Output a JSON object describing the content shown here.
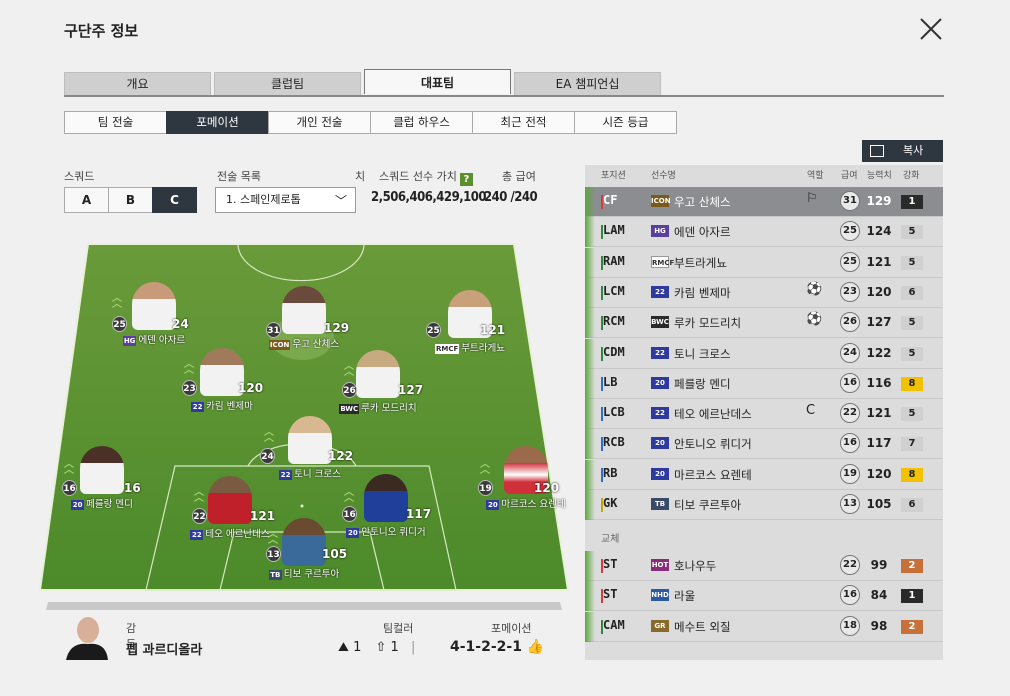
{
  "header": {
    "title": "구단주 정보"
  },
  "main_tabs": [
    "개요",
    "클럽팀",
    "대표팀",
    "EA 챔피언십"
  ],
  "sub_tabs": [
    "팀 전술",
    "포메이션",
    "개인 전술",
    "클럽 하우스",
    "최근 전적",
    "시즌 등급"
  ],
  "squad": {
    "label": "스쿼드",
    "options": [
      "A",
      "B",
      "C"
    ],
    "selected": "C"
  },
  "tactics": {
    "label": "전술 목록",
    "value": "1. 스페인제로톱",
    "cut_label": "치"
  },
  "squad_value": {
    "label": "스쿼드 선수 가치",
    "help": "?",
    "value": "2,506,406,429,100"
  },
  "salary": {
    "label": "총 급여",
    "value": "240 /240"
  },
  "copy_button": {
    "label": "복사",
    "icon_text": "복사"
  },
  "table_headers": {
    "pos": "포지션",
    "name": "선수명",
    "role": "역할",
    "salary": "급여",
    "ovr": "능력치",
    "up": "강화"
  },
  "starters": [
    {
      "pos": "CF",
      "season": "ICON",
      "season_color": "#7a5a1a",
      "name": "우고 산체스",
      "role": "⚐",
      "salary": "31",
      "ovr": "129",
      "up": "1",
      "up_color": "#2a2a2a",
      "pos_color": "#d93a3a",
      "selected": true
    },
    {
      "pos": "LAM",
      "season": "HG",
      "season_color": "#5b3fa0",
      "name": "에덴 아자르",
      "role": "",
      "salary": "25",
      "ovr": "124",
      "up": "5",
      "up_color": "#d0d0d0",
      "pos_color": "#2b8a3e"
    },
    {
      "pos": "RAM",
      "season": "RMCF",
      "season_color": "#ffffff",
      "name": "부트라게뇨",
      "role": "",
      "salary": "25",
      "ovr": "121",
      "up": "5",
      "up_color": "#d0d0d0",
      "pos_color": "#2b8a3e"
    },
    {
      "pos": "LCM",
      "season": "22",
      "season_color": "#2f3a9e",
      "name": "카림 벤제마",
      "role": "⚽",
      "salary": "23",
      "ovr": "120",
      "up": "6",
      "up_color": "#d0d0d0",
      "pos_color": "#2b8a3e"
    },
    {
      "pos": "RCM",
      "season": "BWC",
      "season_color": "#2a2a2a",
      "name": "루카 모드리치",
      "role": "⚽",
      "salary": "26",
      "ovr": "127",
      "up": "5",
      "up_color": "#d0d0d0",
      "pos_color": "#2b8a3e"
    },
    {
      "pos": "CDM",
      "season": "22",
      "season_color": "#2f3a9e",
      "name": "토니 크로스",
      "role": "",
      "salary": "24",
      "ovr": "122",
      "up": "5",
      "up_color": "#d0d0d0",
      "pos_color": "#2b8a3e"
    },
    {
      "pos": "LB",
      "season": "20",
      "season_color": "#2f3a9e",
      "name": "페를랑 멘디",
      "role": "",
      "salary": "16",
      "ovr": "116",
      "up": "8",
      "up_color": "#f2c200",
      "pos_color": "#2a6fc9"
    },
    {
      "pos": "LCB",
      "season": "22",
      "season_color": "#2f3a9e",
      "name": "테오 에르난데스",
      "role": "C",
      "salary": "22",
      "ovr": "121",
      "up": "5",
      "up_color": "#d0d0d0",
      "pos_color": "#2a6fc9"
    },
    {
      "pos": "RCB",
      "season": "20",
      "season_color": "#2f3a9e",
      "name": "안토니오 뤼디거",
      "role": "",
      "salary": "16",
      "ovr": "117",
      "up": "7",
      "up_color": "#d0d0d0",
      "pos_color": "#2a6fc9"
    },
    {
      "pos": "RB",
      "season": "20",
      "season_color": "#2f3a9e",
      "name": "마르코스 요렌테",
      "role": "",
      "salary": "19",
      "ovr": "120",
      "up": "8",
      "up_color": "#f2c200",
      "pos_color": "#2a6fc9"
    },
    {
      "pos": "GK",
      "season": "TB",
      "season_color": "#3a4a6a",
      "name": "티보 쿠르투아",
      "role": "",
      "salary": "13",
      "ovr": "105",
      "up": "6",
      "up_color": "#d0d0d0",
      "pos_color": "#c7a500"
    }
  ],
  "subs_label": "교체",
  "subs": [
    {
      "pos": "ST",
      "season": "HOT",
      "season_color": "#8a2a7a",
      "name": "호나우두",
      "salary": "22",
      "ovr": "99",
      "up": "2",
      "up_color": "#c8703a",
      "pos_color": "#d93a3a"
    },
    {
      "pos": "ST",
      "season": "NHD",
      "season_color": "#2a5aa0",
      "name": "라울",
      "salary": "16",
      "ovr": "84",
      "up": "1",
      "up_color": "#2a2a2a",
      "pos_color": "#d93a3a"
    },
    {
      "pos": "CAM",
      "season": "GR",
      "season_color": "#8a6a2a",
      "name": "메수트 외질",
      "salary": "18",
      "ovr": "98",
      "up": "2",
      "up_color": "#c8703a",
      "pos_color": "#2b8a3e"
    }
  ],
  "pitch_players": [
    {
      "name": "에덴 아자르",
      "season": "HG",
      "season_color": "#5b3fa0",
      "rank": "25",
      "ovr": "24",
      "shirt": "#f2f2f2"
    },
    {
      "name": "우고 산체스",
      "season": "ICON",
      "season_color": "#7a5a1a",
      "rank": "31",
      "ovr": "129",
      "shirt": "#f2f2f2"
    },
    {
      "name": "부트라게뇨",
      "season": "RMCF",
      "season_color": "#ffffff",
      "rank": "25",
      "ovr": "121",
      "shirt": "#f2f2f2"
    },
    {
      "name": "카림 벤제마",
      "season": "22",
      "season_color": "#2f3a9e",
      "rank": "23",
      "ovr": "120",
      "shirt": "#f2f2f2"
    },
    {
      "name": "루카 모드리치",
      "season": "BWC",
      "season_color": "#2a2a2a",
      "rank": "26",
      "ovr": "127",
      "shirt": "#f2f2f2"
    },
    {
      "name": "토니 크로스",
      "season": "22",
      "season_color": "#2f3a9e",
      "rank": "24",
      "ovr": "122",
      "shirt": "#f2f2f2"
    },
    {
      "name": "페를랑 멘디",
      "season": "20",
      "season_color": "#2f3a9e",
      "rank": "16",
      "ovr": "16",
      "shirt": "#f2f2f2"
    },
    {
      "name": "테오 에르난데스",
      "season": "22",
      "season_color": "#2f3a9e",
      "rank": "22",
      "ovr": "121",
      "shirt": "#c0202a"
    },
    {
      "name": "안토니오 뤼디거",
      "season": "20",
      "season_color": "#2f3a9e",
      "rank": "16",
      "ovr": "117",
      "shirt": "#1f3f9a"
    },
    {
      "name": "마르코스 요렌테",
      "season": "20",
      "season_color": "#2f3a9e",
      "rank": "19",
      "ovr": "120",
      "shirt": "#d0303a"
    },
    {
      "name": "티보 쿠르투아",
      "season": "TB",
      "season_color": "#3a4a6a",
      "rank": "13",
      "ovr": "105",
      "shirt": "#3a6a9a"
    }
  ],
  "manager": {
    "label": "감독",
    "name": "펩 과르디올라"
  },
  "team_color": {
    "label": "팀컬러",
    "v1": "1",
    "v2": "1"
  },
  "formation": {
    "label": "포메이션",
    "value": "4-1-2-2-1"
  }
}
